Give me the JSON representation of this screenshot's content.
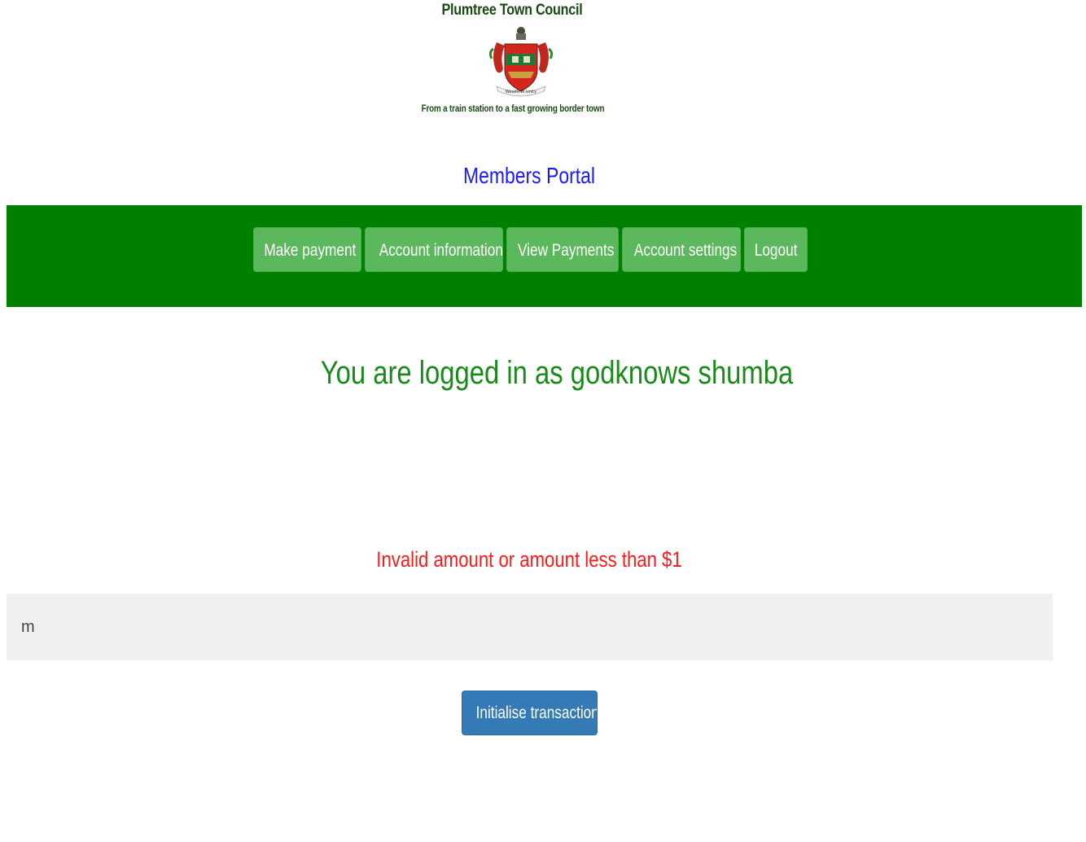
{
  "header": {
    "org_name": "Plumtree Town Council",
    "tagline": "From a train station to a fast growing border town",
    "crest_icon": "coat-of-arms-icon",
    "crest_motto": "Wealth in Unity"
  },
  "portal_title": "Members Portal",
  "nav": {
    "items": [
      {
        "label": "Make payment"
      },
      {
        "label": "Account information"
      },
      {
        "label": "View Payments"
      },
      {
        "label": "Account settings"
      },
      {
        "label": "Logout"
      }
    ]
  },
  "session": {
    "logged_in_text": "You are logged in as godknows shumba"
  },
  "payment": {
    "error_text": "Invalid amount or amount less than $1",
    "amount_value": "m",
    "submit_label": "Initialise transaction"
  },
  "colors": {
    "nav_bg": "#008000",
    "nav_button": "#5cb85c",
    "primary_button": "#337ab7",
    "error": "#ff1a1a",
    "portal_title": "#1a1aff",
    "logged_in": "#1a8a1a"
  }
}
